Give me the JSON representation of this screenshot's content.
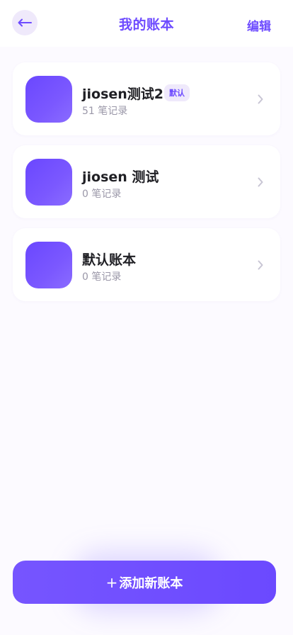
{
  "header": {
    "title": "我的账本",
    "edit_label": "编辑",
    "back_icon": "arrow-left-icon"
  },
  "books": [
    {
      "name": "jiosen测试2",
      "badge": "默认",
      "count": "51 笔记录"
    },
    {
      "name": "jiosen 测试",
      "badge": "",
      "count": "0 笔记录"
    },
    {
      "name": "默认账本",
      "badge": "",
      "count": "0 笔记录"
    }
  ],
  "footer": {
    "plus": "+",
    "add_label": "添加新账本"
  },
  "colors": {
    "accent": "#6d4bff",
    "background": "#fcfaff",
    "badge_bg": "#efe9fb"
  }
}
